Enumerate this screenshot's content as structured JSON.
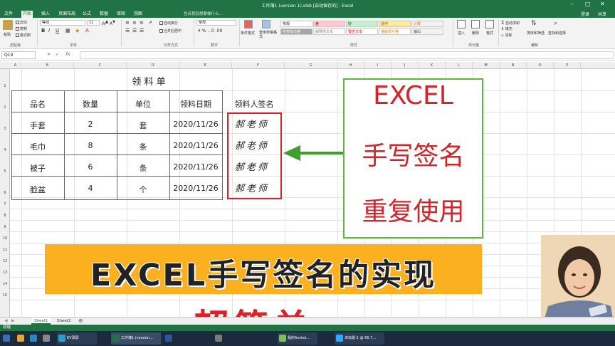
{
  "window": {
    "title": "工作簿1 (version 1).xlsb [自动保存的] - Excel"
  },
  "tabs": [
    "文件",
    "开始",
    "插入",
    "页面布局",
    "公式",
    "数据",
    "审阅",
    "视图"
  ],
  "tell_me": "告诉我您想要做什么...",
  "account": {
    "login": "登录",
    "share": "共享"
  },
  "ribbon": {
    "clipboard": {
      "paste": "粘贴",
      "cut": "剪切",
      "copy": "复制",
      "format_painter": "格式刷",
      "label": "剪贴板"
    },
    "font": {
      "name": "等线",
      "size": "11",
      "label": "字体"
    },
    "alignment": {
      "wrap": "自动换行",
      "merge": "合并后居中",
      "label": "对齐方式"
    },
    "number": {
      "format": "常规",
      "label": "数字"
    },
    "styles": {
      "conditional": "条件格式",
      "table": "套用表格格式",
      "cells": [
        {
          "label": "常规",
          "bg": "#ffffff",
          "color": "#222222"
        },
        {
          "label": "差",
          "bg": "#ffc7ce",
          "color": "#9c0006"
        },
        {
          "label": "好",
          "bg": "#c6efce",
          "color": "#006100"
        },
        {
          "label": "适中",
          "bg": "#ffeb9c",
          "color": "#9c5700"
        },
        {
          "label": "计算",
          "bg": "#f2f2f2",
          "color": "#fa7d00"
        },
        {
          "label": "检查单元格",
          "bg": "#a5a5a5",
          "color": "#ffffff"
        },
        {
          "label": "解释性文本",
          "bg": "#ffffff",
          "color": "#7f7f7f"
        },
        {
          "label": "警告文本",
          "bg": "#ffffff",
          "color": "#ff0000"
        },
        {
          "label": "链接单元格",
          "bg": "#ffffff",
          "color": "#fa7d00"
        },
        {
          "label": "输出",
          "bg": "#f2f2f2",
          "color": "#3f3f3f"
        }
      ],
      "label": "样式"
    },
    "cells_group": {
      "insert": "插入",
      "delete": "删除",
      "format": "格式",
      "label": "单元格"
    },
    "editing": {
      "autosum": "自动求和",
      "fill": "填充",
      "clear": "清除",
      "sort": "排序和筛选",
      "find": "查找和选择",
      "label": "编辑"
    }
  },
  "name_box": "Q19",
  "columns": [
    "A",
    "B",
    "C",
    "D",
    "E",
    "F",
    "G",
    "H",
    "I",
    "J",
    "K",
    "L",
    "M",
    "N",
    "O",
    "P"
  ],
  "rows": [
    "1",
    "2",
    "3",
    "4",
    "5",
    "6",
    "7",
    "8",
    "9",
    "10",
    "11",
    "12",
    "13",
    "14",
    "15"
  ],
  "table": {
    "title": "领 料 单",
    "headers": [
      "品名",
      "数量",
      "单位",
      "领料日期",
      "领料人签名"
    ],
    "rows": [
      {
        "item": "手套",
        "qty": "2",
        "unit": "套",
        "date": "2020/11/26",
        "sign": "郝老师"
      },
      {
        "item": "毛巾",
        "qty": "8",
        "unit": "条",
        "date": "2020/11/26",
        "sign": "郝老师"
      },
      {
        "item": "被子",
        "qty": "6",
        "unit": "条",
        "date": "2020/11/26",
        "sign": "郝老师"
      },
      {
        "item": "脸盆",
        "qty": "4",
        "unit": "个",
        "date": "2020/11/26",
        "sign": "郝老师"
      }
    ]
  },
  "callout": {
    "line1": "EXCEL",
    "line2": "手写签名",
    "line3": "重复使用"
  },
  "banner": {
    "main": "EXCEL手写签名的实现",
    "sub": "超简单"
  },
  "sheets": [
    "Sheet1",
    "Sheet2"
  ],
  "status": "就绪",
  "taskbar": {
    "items": [
      "EV录屏",
      "工作簿1 (version...",
      "",
      "",
      "我的Androi...",
      "",
      "",
      "未标题-1 @ 66.7..."
    ]
  },
  "colors": {
    "excel_green": "#217346",
    "accent_red": "#d8232a",
    "callout_green": "#5db83b",
    "banner_orange": "#fbb11f"
  }
}
